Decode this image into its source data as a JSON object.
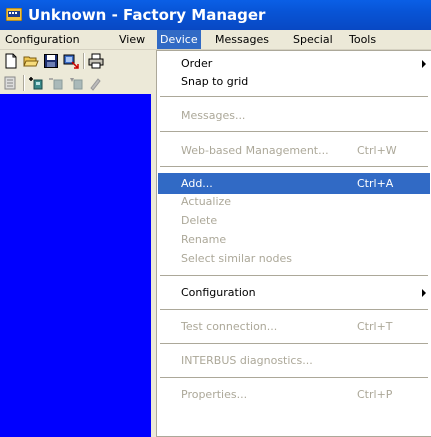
{
  "window": {
    "title": "Unknown - Factory Manager"
  },
  "menubar": {
    "items": [
      "Configuration",
      "View",
      "Device",
      "Messages",
      "Special",
      "Tools"
    ],
    "active": "Device"
  },
  "dropdown": {
    "items": [
      {
        "label": "Order",
        "shortcut": "",
        "disabled": false,
        "submenu": true
      },
      {
        "label": "Snap to grid",
        "shortcut": "",
        "disabled": false,
        "submenu": false
      },
      {
        "label": "Messages...",
        "shortcut": "",
        "disabled": true,
        "submenu": false
      },
      {
        "label": "Web-based Management...",
        "shortcut": "Ctrl+W",
        "disabled": true,
        "submenu": false
      },
      {
        "label": "Add...",
        "shortcut": "Ctrl+A",
        "disabled": false,
        "submenu": false,
        "selected": true
      },
      {
        "label": "Actualize",
        "shortcut": "",
        "disabled": true,
        "submenu": false
      },
      {
        "label": "Delete",
        "shortcut": "",
        "disabled": true,
        "submenu": false
      },
      {
        "label": "Rename",
        "shortcut": "",
        "disabled": true,
        "submenu": false
      },
      {
        "label": "Select similar nodes",
        "shortcut": "",
        "disabled": true,
        "submenu": false
      },
      {
        "label": "Configuration",
        "shortcut": "",
        "disabled": false,
        "submenu": true
      },
      {
        "label": "Test connection...",
        "shortcut": "Ctrl+T",
        "disabled": true,
        "submenu": false
      },
      {
        "label": "INTERBUS diagnostics...",
        "shortcut": "",
        "disabled": true,
        "submenu": false
      },
      {
        "label": "Properties...",
        "shortcut": "Ctrl+P",
        "disabled": true,
        "submenu": false
      }
    ]
  },
  "colors": {
    "titlebar": "#0854d6",
    "selection": "#316ac5",
    "disabled_text": "#aca899",
    "workspace": "#0000ff",
    "chrome": "#ece9d8"
  },
  "icons": {
    "toolbar1": [
      "new-file-icon",
      "open-folder-icon",
      "save-icon",
      "import-icon",
      "print-icon"
    ],
    "toolbar2": [
      "device-list-icon",
      "add-device-icon",
      "remove-device-icon",
      "device-edit-icon",
      "device-tool-icon"
    ]
  }
}
